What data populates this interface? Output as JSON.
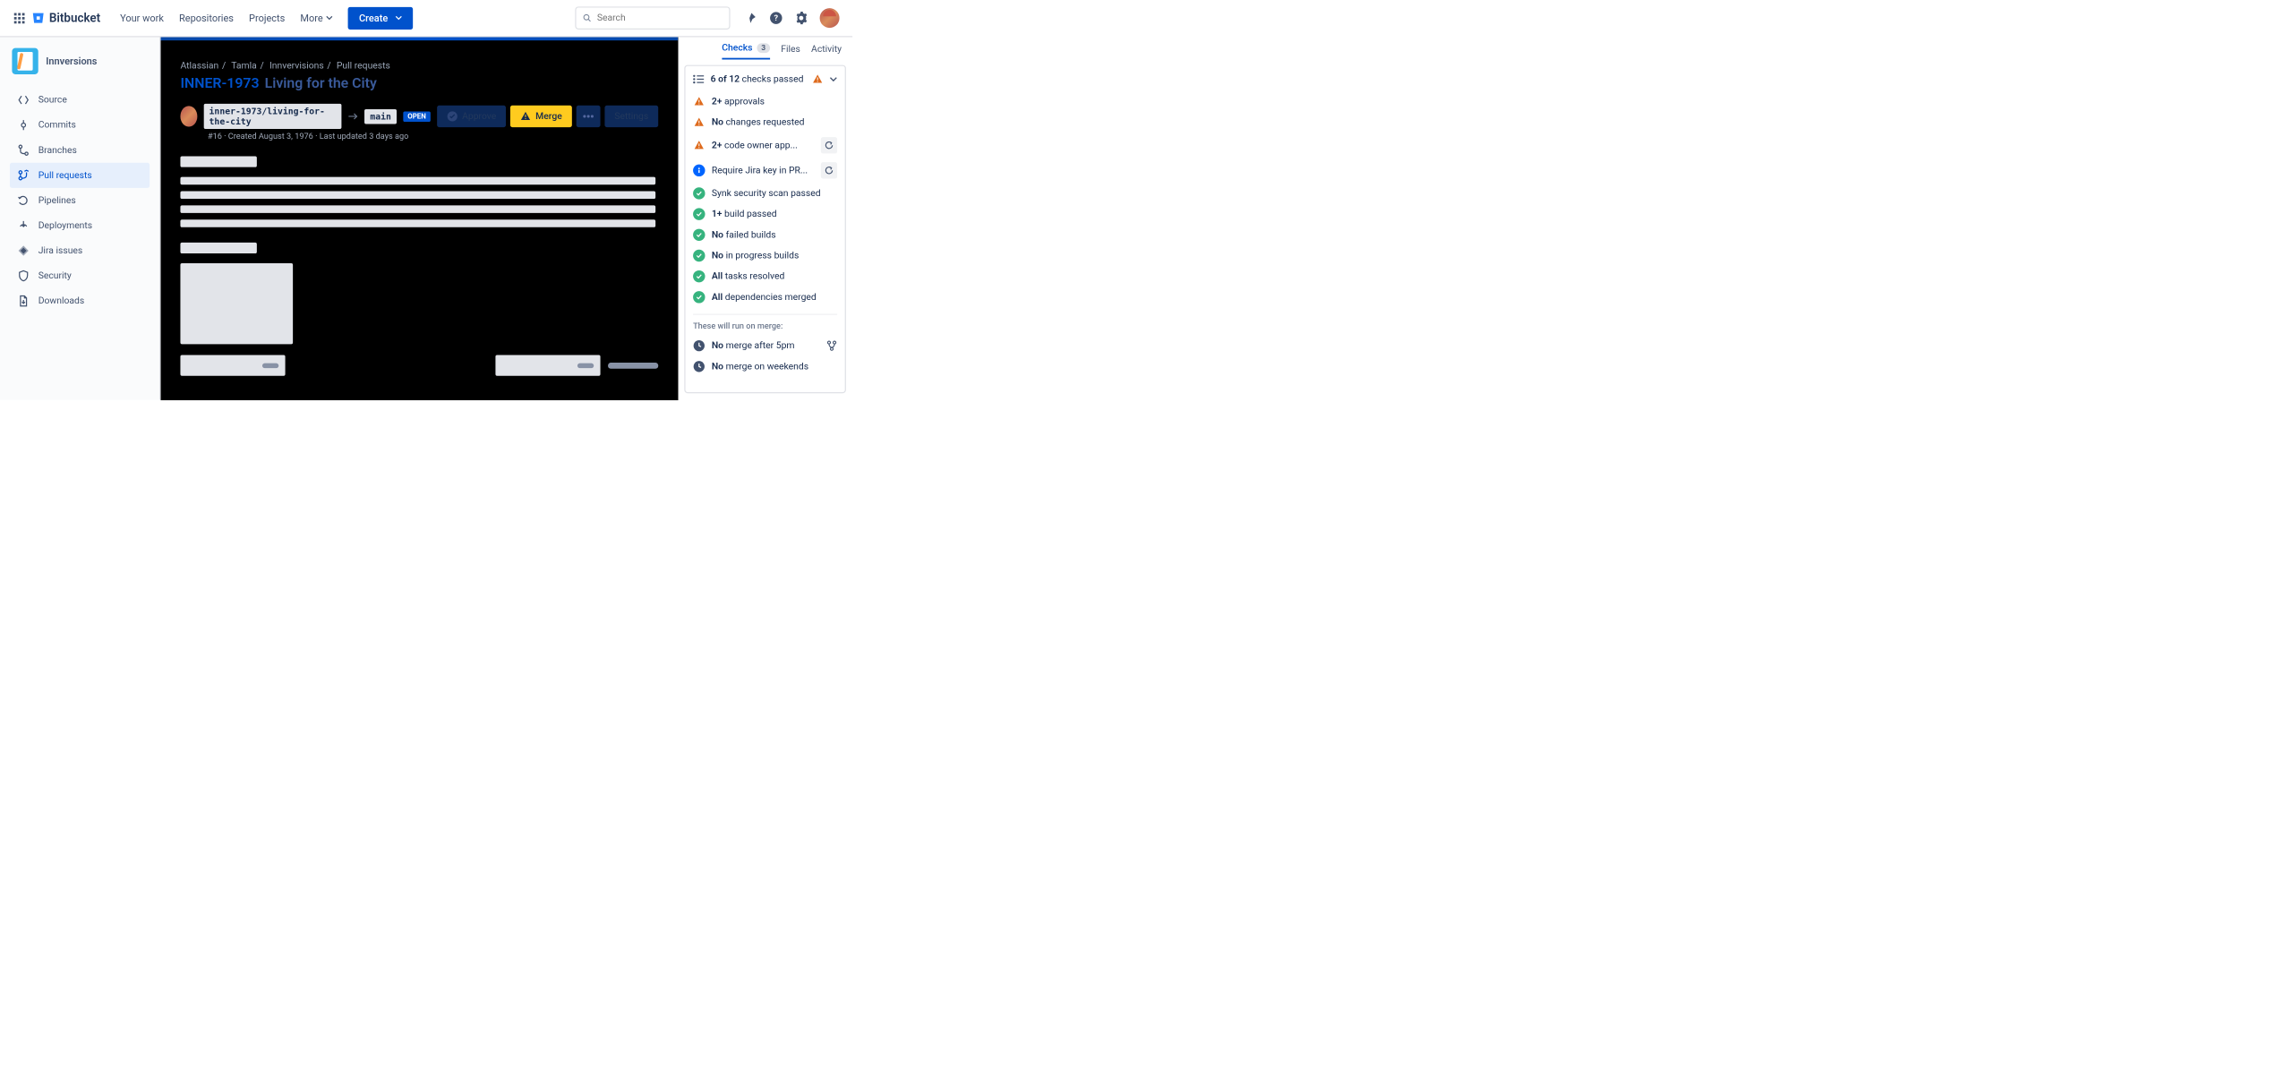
{
  "header": {
    "brand": "Bitbucket",
    "nav": {
      "your_work": "Your work",
      "repositories": "Repositories",
      "projects": "Projects",
      "more": "More"
    },
    "create": "Create",
    "search_placeholder": "Search"
  },
  "sidebar": {
    "project_name": "Innversions",
    "items": [
      {
        "label": "Source"
      },
      {
        "label": "Commits"
      },
      {
        "label": "Branches"
      },
      {
        "label": "Pull requests"
      },
      {
        "label": "Pipelines"
      },
      {
        "label": "Deployments"
      },
      {
        "label": "Jira issues"
      },
      {
        "label": "Security"
      },
      {
        "label": "Downloads"
      }
    ]
  },
  "breadcrumbs": {
    "a": "Atlassian",
    "b": "Tamla",
    "c": "Innvervisions",
    "d": "Pull requests"
  },
  "pr": {
    "key": "INNER-1973",
    "title": "Living for the City",
    "source_branch": "inner-1973/living-for-the-city",
    "dest_branch": "main",
    "status": "OPEN",
    "meta": "#16 · Created August 3, 1976 · Last updated 3 days ago",
    "buttons": {
      "approve": "Approve",
      "merge": "Merge",
      "settings": "Settings"
    }
  },
  "panel": {
    "tabs": {
      "checks": "Checks",
      "checks_badge": "3",
      "files": "Files",
      "activity": "Activity"
    },
    "summary_prefix": "6 of 12",
    "summary_suffix": "checks passed",
    "checks": [
      {
        "icon": "warn",
        "bold": "2+",
        "text": "approvals"
      },
      {
        "icon": "warn",
        "bold": "No",
        "text": "changes requested"
      },
      {
        "icon": "warn",
        "bold": "2+",
        "text": "code owner app...",
        "retry": true
      },
      {
        "icon": "info",
        "bold": "",
        "text": "Require Jira key in PR...",
        "retry": true
      },
      {
        "icon": "pass",
        "bold": "",
        "text": "Synk security scan passed"
      },
      {
        "icon": "pass",
        "bold": "1+",
        "text": "build passed"
      },
      {
        "icon": "pass",
        "bold": "No",
        "text": "failed builds"
      },
      {
        "icon": "pass",
        "bold": "No",
        "text": "in progress builds"
      },
      {
        "icon": "pass",
        "bold": "All",
        "text": "tasks resolved"
      },
      {
        "icon": "pass",
        "bold": "All",
        "text": "dependencies merged"
      }
    ],
    "on_merge_heading": "These will run on merge:",
    "on_merge": [
      {
        "bold": "No",
        "text": "merge after 5pm",
        "action": "branch"
      },
      {
        "bold": "No",
        "text": "merge on weekends"
      }
    ]
  }
}
